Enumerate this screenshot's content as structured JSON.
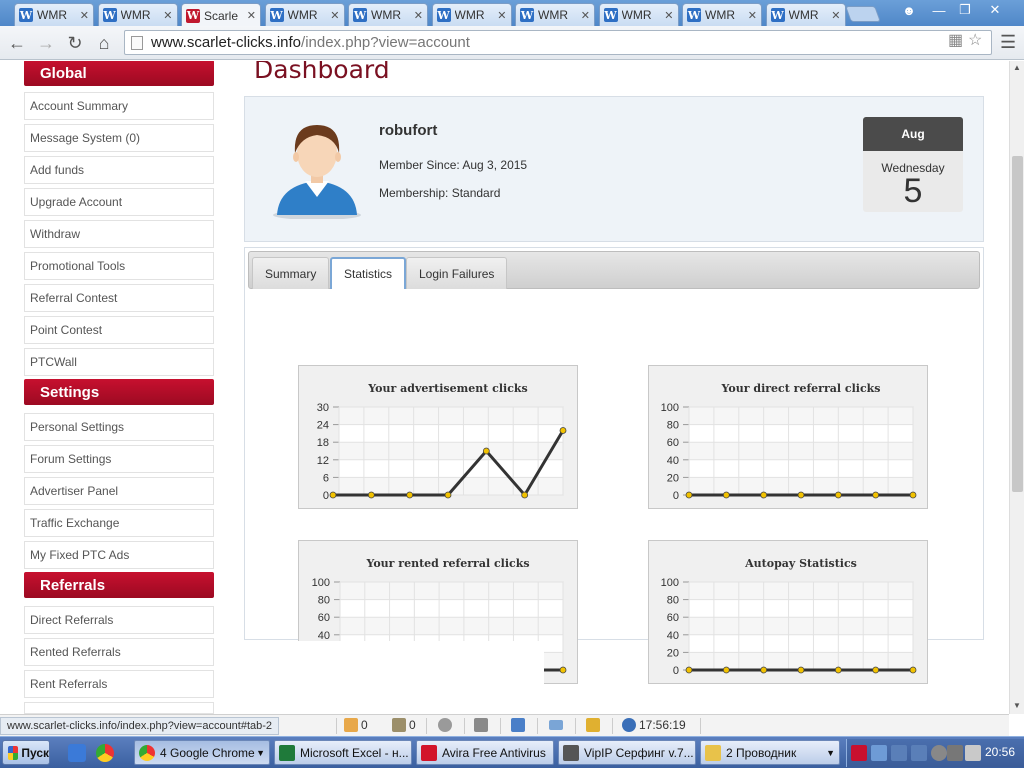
{
  "browser": {
    "tabs": [
      {
        "title": "WMR",
        "active": false
      },
      {
        "title": "WMR",
        "active": false
      },
      {
        "title": "Scarle",
        "active": true
      },
      {
        "title": "WMR",
        "active": false
      },
      {
        "title": "WMR",
        "active": false
      },
      {
        "title": "WMR",
        "active": false
      },
      {
        "title": "WMR",
        "active": false
      },
      {
        "title": "WMR",
        "active": false
      },
      {
        "title": "WMR",
        "active": false
      },
      {
        "title": "WMR",
        "active": false
      }
    ],
    "url_host": "www.scarlet-clicks.info",
    "url_path": "/index.php?view=account",
    "status_url": "www.scarlet-clicks.info/index.php?view=account#tab-2"
  },
  "sidebar": {
    "sections": [
      {
        "title": "Global",
        "items": [
          "Account Summary",
          "Message System (0)",
          "Add funds",
          "Upgrade Account",
          "Withdraw",
          "Promotional Tools",
          "Referral Contest",
          "Point Contest",
          "PTCWall"
        ]
      },
      {
        "title": "Settings",
        "items": [
          "Personal Settings",
          "Forum Settings",
          "Advertiser Panel",
          "Traffic Exchange",
          "My Fixed PTC Ads"
        ]
      },
      {
        "title": "Referrals",
        "items": [
          "Direct Referrals",
          "Rented Referrals",
          "Rent Referrals"
        ]
      }
    ]
  },
  "main": {
    "title": "Dashboard",
    "username": "robufort",
    "member_since": "Member Since: Aug 3, 2015",
    "membership": "Membership: Standard",
    "calendar": {
      "month": "Aug",
      "weekday": "Wednesday",
      "day": "5"
    },
    "tabs": [
      {
        "label": "Summary",
        "active": false
      },
      {
        "label": "Statistics",
        "active": true
      },
      {
        "label": "Login Failures",
        "active": false
      }
    ]
  },
  "chart_data": [
    {
      "type": "line",
      "title": "Your advertisement clicks",
      "x": [
        1,
        2,
        3,
        4,
        5,
        6,
        7
      ],
      "series": [
        {
          "values": [
            0,
            0,
            0,
            0,
            15,
            0,
            22
          ]
        }
      ],
      "ylim": [
        0,
        30
      ],
      "yticks": [
        0,
        6,
        12,
        18,
        24,
        30
      ],
      "grid": true
    },
    {
      "type": "line",
      "title": "Your direct referral clicks",
      "x": [
        1,
        2,
        3,
        4,
        5,
        6,
        7
      ],
      "series": [
        {
          "values": [
            0,
            0,
            0,
            0,
            0,
            0,
            0
          ]
        }
      ],
      "ylim": [
        0,
        100
      ],
      "yticks": [
        0,
        20,
        40,
        60,
        80,
        100
      ],
      "grid": true
    },
    {
      "type": "line",
      "title": "Your rented referral clicks",
      "x": [
        1,
        2,
        3,
        4,
        5,
        6,
        7
      ],
      "series": [
        {
          "values": [
            0,
            0,
            0,
            0,
            0,
            0,
            0
          ]
        }
      ],
      "ylim": [
        0,
        100
      ],
      "yticks": [
        0,
        20,
        40,
        60,
        80,
        100
      ],
      "grid": true
    },
    {
      "type": "line",
      "title": "Autopay Statistics",
      "x": [
        1,
        2,
        3,
        4,
        5,
        6,
        7
      ],
      "series": [
        {
          "values": [
            0,
            0,
            0,
            0,
            0,
            0,
            0
          ]
        }
      ],
      "ylim": [
        0,
        100
      ],
      "yticks": [
        0,
        20,
        40,
        60,
        80,
        100
      ],
      "grid": true
    }
  ],
  "statusbar": {
    "count1": "0",
    "count2": "0",
    "time": "17:56:19"
  },
  "taskbar": {
    "start": "Пуск",
    "tasks": [
      "4 Google Chrome",
      "Microsoft Excel - н...",
      "Avira Free Antivirus",
      "VipIP Серфинг v.7...",
      "2 Проводник"
    ],
    "clock": "20:56"
  },
  "colors": {
    "accent": "#b00d28",
    "line": "#333333",
    "point": "#f2c200"
  }
}
